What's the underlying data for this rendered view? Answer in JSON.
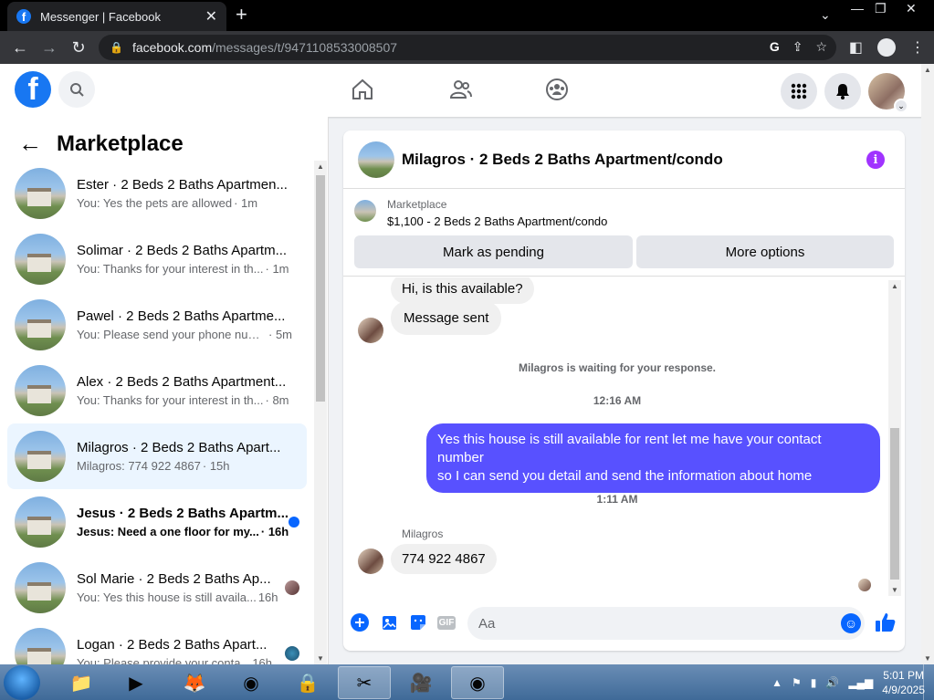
{
  "browser": {
    "tab_title": "Messenger | Facebook",
    "url_host": "facebook.com",
    "url_path": "/messages/t/9471108533008507"
  },
  "left_panel": {
    "title": "Marketplace",
    "conversations": [
      {
        "name": "Ester · 2 Beds 2 Baths Apartmen...",
        "snippet": "You: Yes the pets are allowed",
        "time": "· 1m"
      },
      {
        "name": "Solimar · 2 Beds 2 Baths Apartm...",
        "snippet": "You: Thanks for your interest in th...",
        "time": "· 1m"
      },
      {
        "name": "Pawel · 2 Beds 2 Baths Apartme...",
        "snippet": "You: Please send your phone num...",
        "time": "· 5m"
      },
      {
        "name": "Alex · 2 Beds 2 Baths Apartment...",
        "snippet": "You: Thanks for your interest in th...",
        "time": "· 8m"
      },
      {
        "name": "Milagros · 2 Beds 2 Baths Apart...",
        "snippet": "Milagros: 774 922 4867",
        "time": "· 15h"
      },
      {
        "name": "Jesus · 2 Beds 2 Baths Apartm...",
        "snippet": "Jesus: Need a one floor for my...",
        "time": "· 16h"
      },
      {
        "name": "Sol Marie · 2 Beds 2 Baths Ap...",
        "snippet": "You: Yes this house is still availa...",
        "time": "16h"
      },
      {
        "name": "Logan · 2 Beds 2 Baths Apart...",
        "snippet": "You: Please provide your conta...",
        "time": "16h"
      }
    ]
  },
  "chat": {
    "header_title": "Milagros · 2 Beds 2 Baths Apartment/condo",
    "marketplace_label": "Marketplace",
    "product": "$1,100 - 2 Beds 2 Baths Apartment/condo",
    "mark_pending": "Mark as pending",
    "more_options": "More options",
    "msg_1": "Hi, is this available?",
    "msg_2": "Message sent",
    "waiting": "Milagros is waiting for your response.",
    "time_1": "12:16 AM",
    "out_line1": "Yes this house is still available for rent let me have your contact number",
    "out_line2": "so I can send you detail and send the information about home",
    "time_2": "1:11 AM",
    "sender": "Milagros",
    "msg_3": "774 922 4867",
    "input_placeholder": "Aa",
    "gif_label": "GIF"
  },
  "taskbar": {
    "time": "5:01 PM",
    "date": "4/9/2025"
  },
  "colors": {
    "fb_blue": "#1877f2",
    "outgoing_bubble": "#5851ff",
    "info_purple": "#a033ff",
    "active_conv": "#ebf5ff"
  }
}
